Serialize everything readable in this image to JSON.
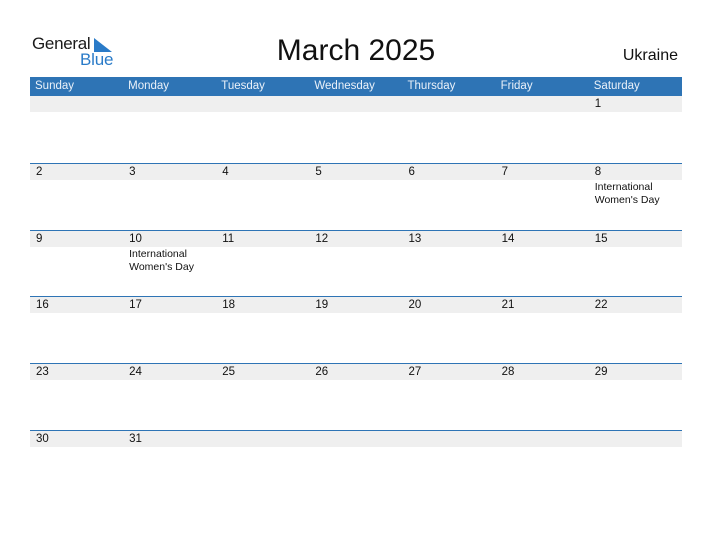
{
  "logo": {
    "word1": "General",
    "word2": "Blue",
    "icon": "triangle-flag-icon"
  },
  "title": "March 2025",
  "country": "Ukraine",
  "colors": {
    "header_bg": "#2e74b5",
    "day_band": "#efefef",
    "brand_blue": "#2a7bc8"
  },
  "weekdays": [
    "Sunday",
    "Monday",
    "Tuesday",
    "Wednesday",
    "Thursday",
    "Friday",
    "Saturday"
  ],
  "weeks": [
    {
      "days": [
        {
          "n": ""
        },
        {
          "n": ""
        },
        {
          "n": ""
        },
        {
          "n": ""
        },
        {
          "n": ""
        },
        {
          "n": ""
        },
        {
          "n": "1"
        }
      ]
    },
    {
      "days": [
        {
          "n": "2"
        },
        {
          "n": "3"
        },
        {
          "n": "4"
        },
        {
          "n": "5"
        },
        {
          "n": "6"
        },
        {
          "n": "7"
        },
        {
          "n": "8",
          "event": "International Women's Day"
        }
      ]
    },
    {
      "days": [
        {
          "n": "9"
        },
        {
          "n": "10",
          "event": "International Women's Day"
        },
        {
          "n": "11"
        },
        {
          "n": "12"
        },
        {
          "n": "13"
        },
        {
          "n": "14"
        },
        {
          "n": "15"
        }
      ]
    },
    {
      "days": [
        {
          "n": "16"
        },
        {
          "n": "17"
        },
        {
          "n": "18"
        },
        {
          "n": "19"
        },
        {
          "n": "20"
        },
        {
          "n": "21"
        },
        {
          "n": "22"
        }
      ]
    },
    {
      "days": [
        {
          "n": "23"
        },
        {
          "n": "24"
        },
        {
          "n": "25"
        },
        {
          "n": "26"
        },
        {
          "n": "27"
        },
        {
          "n": "28"
        },
        {
          "n": "29"
        }
      ]
    },
    {
      "days": [
        {
          "n": "30"
        },
        {
          "n": "31"
        },
        {
          "n": ""
        },
        {
          "n": ""
        },
        {
          "n": ""
        },
        {
          "n": ""
        },
        {
          "n": ""
        }
      ]
    }
  ]
}
